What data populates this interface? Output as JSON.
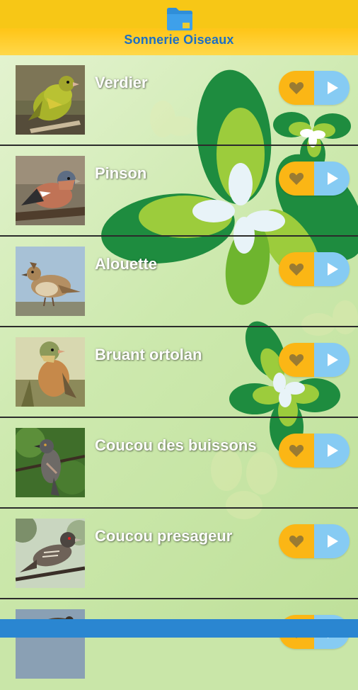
{
  "app": {
    "title": "Sonnerie Oiseaux",
    "icon": "folder-icon"
  },
  "colors": {
    "header": "#ffc61a",
    "title": "#1d6fc4",
    "favorite": "#fbb615",
    "play": "#86cbf3",
    "bottom_bar": "#2a86d1"
  },
  "birds": [
    {
      "name": "Verdier",
      "photo": "verdier-photo"
    },
    {
      "name": "Pinson",
      "photo": "pinson-photo"
    },
    {
      "name": "Alouette",
      "photo": "alouette-photo"
    },
    {
      "name": "Bruant ortolan",
      "photo": "bruant-ortolan-photo"
    },
    {
      "name": "Coucou des buissons",
      "photo": "coucou-des-buissons-photo"
    },
    {
      "name": "Coucou presageur",
      "photo": "coucou-presageur-photo"
    },
    {
      "name": "",
      "photo": "partial-bird-photo"
    }
  ],
  "row_actions": {
    "favorite_icon": "heart-icon",
    "play_icon": "play-icon"
  }
}
